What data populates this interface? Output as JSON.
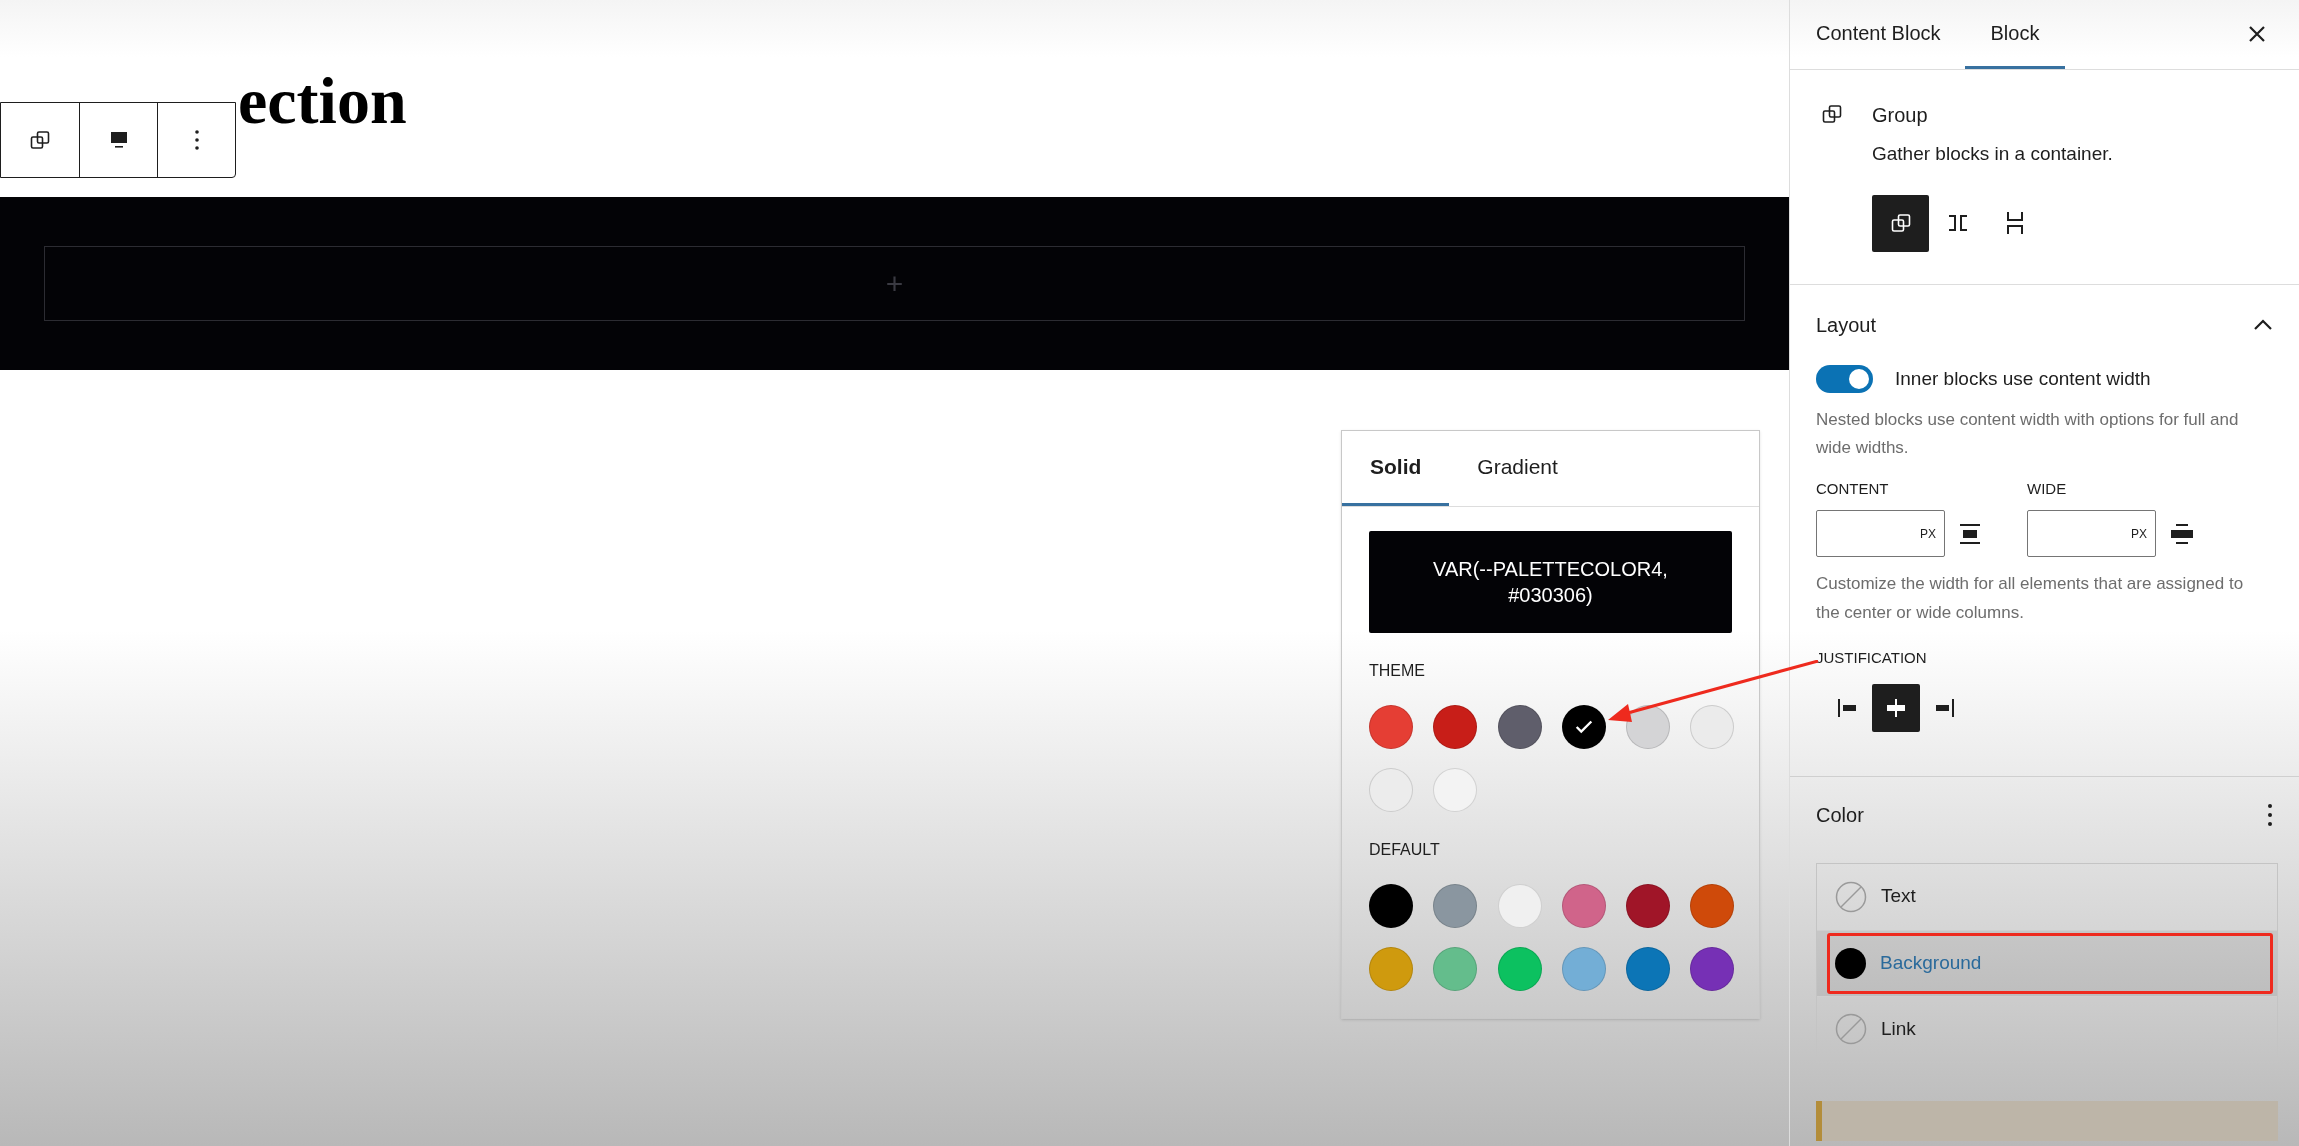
{
  "canvas": {
    "heading": "ection",
    "block_toolbar": [
      {
        "kind": "group"
      },
      {
        "kind": "align"
      },
      {
        "kind": "more"
      }
    ],
    "inserter": {
      "symbol": "+"
    }
  },
  "color_popover": {
    "tabs": [
      {
        "label": "Solid",
        "selected": true
      },
      {
        "label": "Gradient",
        "selected": false
      }
    ],
    "current_value": "VAR(--PALETTECOLOR4, #030306)",
    "theme_label": "THEME",
    "theme_swatches": [
      {
        "color": "#e53e34",
        "selected": false
      },
      {
        "color": "#c81e18",
        "selected": false
      },
      {
        "color": "#5f5e6b",
        "selected": false
      },
      {
        "color": "#000000",
        "selected": true
      },
      {
        "color": "#d4d4d6",
        "selected": false
      },
      {
        "color": "#ebebeb",
        "selected": false
      },
      {
        "color": "#ececec",
        "selected": false
      },
      {
        "color": "#f3f3f3",
        "selected": false
      }
    ],
    "default_label": "DEFAULT",
    "default_swatches": [
      {
        "color": "#000000",
        "selected": false
      },
      {
        "color": "#8a96a0",
        "selected": false
      },
      {
        "color": "#f0f0f0",
        "selected": false
      },
      {
        "color": "#d0648a",
        "selected": false
      },
      {
        "color": "#a01528",
        "selected": false
      },
      {
        "color": "#cf4a0a",
        "selected": false
      },
      {
        "color": "#cf9a0e",
        "selected": false
      },
      {
        "color": "#64bd8c",
        "selected": false
      },
      {
        "color": "#0cc160",
        "selected": false
      },
      {
        "color": "#73aed6",
        "selected": false
      },
      {
        "color": "#0c75b6",
        "selected": false
      },
      {
        "color": "#7630b5",
        "selected": false
      }
    ]
  },
  "sidebar": {
    "tabs": [
      {
        "label": "Content Block",
        "selected": false
      },
      {
        "label": "Block",
        "selected": true
      }
    ],
    "block": {
      "name": "Group",
      "description": "Gather blocks in a container.",
      "variants": [
        {
          "kind": "group",
          "selected": true
        },
        {
          "kind": "row",
          "selected": false
        },
        {
          "kind": "stack",
          "selected": false
        }
      ]
    },
    "layout": {
      "title": "Layout",
      "expanded": true,
      "toggle": {
        "label": "Inner blocks use content width",
        "on": true
      },
      "help": "Nested blocks use content width with options for full and wide widths.",
      "fields": [
        {
          "label": "CONTENT",
          "unit": "PX",
          "kind": "content"
        },
        {
          "label": "WIDE",
          "unit": "PX",
          "kind": "wide"
        }
      ],
      "width_help": "Customize the width for all elements that are assigned to the center or wide columns.",
      "justification_label": "JUSTIFICATION",
      "justification": [
        {
          "kind": "left",
          "selected": false
        },
        {
          "kind": "center",
          "selected": true
        },
        {
          "kind": "right",
          "selected": false
        }
      ]
    },
    "color": {
      "title": "Color",
      "items": [
        {
          "label": "Text",
          "selected": false
        },
        {
          "label": "Background",
          "selected": true,
          "color": "#000000"
        },
        {
          "label": "Link",
          "selected": false
        }
      ]
    }
  }
}
